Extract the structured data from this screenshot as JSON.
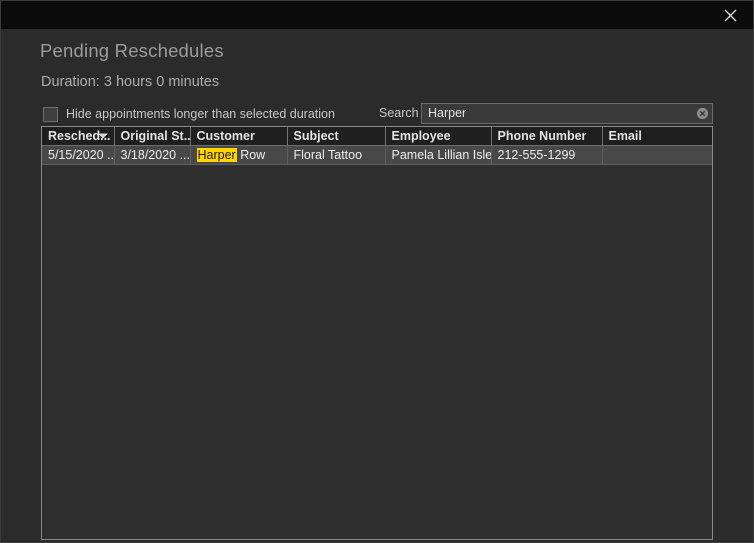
{
  "window": {
    "close_icon": "close-icon"
  },
  "dialog": {
    "title": "Pending Reschedules",
    "subtitle": "Duration: 3 hours 0 minutes"
  },
  "filters": {
    "hide_checkbox_label": "Hide appointments longer than selected duration",
    "hide_checkbox_checked": false,
    "search_label": "Search",
    "search_value": "Harper",
    "search_placeholder": "",
    "clear_icon": "clear-circle-icon"
  },
  "grid": {
    "sort_column": "Resched...",
    "sort_direction": "descending",
    "columns": [
      {
        "label": "Resched...",
        "sorted": true
      },
      {
        "label": "Original St...",
        "sorted": false
      },
      {
        "label": "Customer",
        "sorted": false
      },
      {
        "label": "Subject",
        "sorted": false
      },
      {
        "label": "Employee",
        "sorted": false
      },
      {
        "label": "Phone Number",
        "sorted": false
      },
      {
        "label": "Email",
        "sorted": false
      }
    ],
    "rows": [
      {
        "rescheduled": "5/15/2020 ...",
        "original_start": "3/18/2020 ...",
        "customer_highlight": "Harper",
        "customer_rest": " Row",
        "subject": "Floral Tattoo",
        "employee": "Pamela Lillian Isley",
        "phone": "212-555-1299",
        "email": ""
      }
    ]
  },
  "colors": {
    "titlebar": "#0b0b0b",
    "dialog_bg": "#2b2b2b",
    "header_bg": "#1f1f1f",
    "row_bg": "#484848",
    "highlight": "#ffd400",
    "grid_border": "#8a8a8a"
  }
}
